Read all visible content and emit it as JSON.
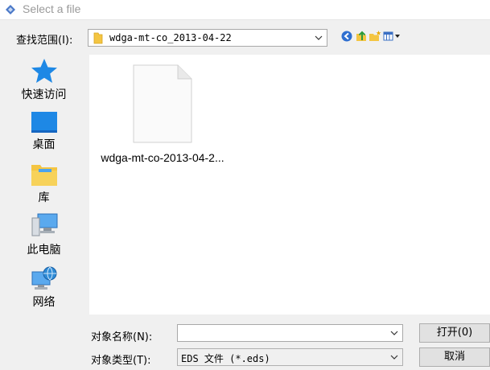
{
  "window": {
    "title": "Select a file"
  },
  "look_in": {
    "label": "查找范围(I):",
    "path": "wdga-mt-co_2013-04-22"
  },
  "toolbar": {
    "icons": [
      "back-icon",
      "up-folder-icon",
      "new-folder-icon",
      "view-menu-icon"
    ]
  },
  "sidebar": {
    "items": [
      {
        "label": "快速访问",
        "icon": "quick-access-star-icon"
      },
      {
        "label": "桌面",
        "icon": "desktop-icon"
      },
      {
        "label": "库",
        "icon": "libraries-icon"
      },
      {
        "label": "此电脑",
        "icon": "this-pc-icon"
      },
      {
        "label": "网络",
        "icon": "network-icon"
      }
    ]
  },
  "files": [
    {
      "name": "wdga-mt-co-2013-04-2...",
      "icon": "blank-file-icon"
    }
  ],
  "object_name": {
    "label": "对象名称(N):",
    "value": ""
  },
  "object_type": {
    "label": "对象类型(T):",
    "value": "EDS 文件 (*.eds)"
  },
  "buttons": {
    "open": "打开(0)",
    "cancel": "取消"
  },
  "colors": {
    "accent": "#1e88e5",
    "folder": "#f4c542"
  }
}
